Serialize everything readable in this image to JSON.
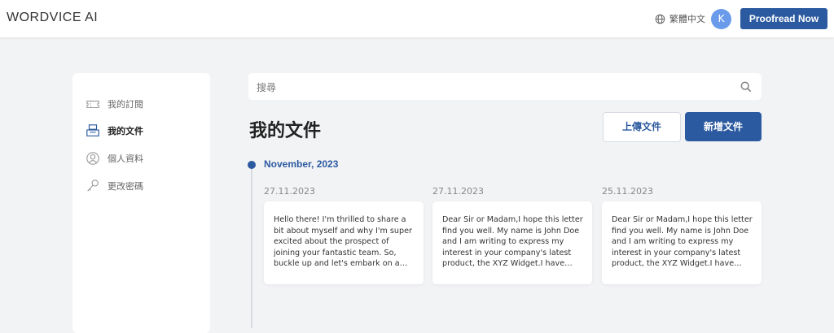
{
  "header": {
    "logo": "WORDVICE AI",
    "language": "繁體中文",
    "avatar_initial": "K",
    "proofread_label": "Proofread Now"
  },
  "sidebar": {
    "items": [
      {
        "label": "我的訂閱",
        "icon": "ticket-icon",
        "active": false
      },
      {
        "label": "我的文件",
        "icon": "document-stack-icon",
        "active": true
      },
      {
        "label": "個人資料",
        "icon": "profile-icon",
        "active": false
      },
      {
        "label": "更改密碼",
        "icon": "key-icon",
        "active": false
      }
    ]
  },
  "search": {
    "placeholder": "搜尋"
  },
  "main": {
    "title": "我的文件",
    "upload_label": "上傳文件",
    "new_label": "新增文件",
    "month": "November, 2023",
    "documents": [
      {
        "date": "27.11.2023",
        "preview": "Hello there! I'm thrilled to share a bit about myself and why I'm super excited about the prospect of joining your fantastic team. So, buckle up and let's embark on a journey"
      },
      {
        "date": "27.11.2023",
        "preview": "Dear Sir or Madam,I hope this letter find you well. My name is John Doe and I am writing to express my interest in your company's latest product, the XYZ Widget.I have been"
      },
      {
        "date": "25.11.2023",
        "preview": "Dear Sir or Madam,I hope this letter find you well. My name is John Doe and I am writing to express my interest in your company's latest product, the XYZ Widget.I have been"
      }
    ]
  },
  "colors": {
    "primary": "#2c5aa0",
    "avatar": "#6a9bea",
    "background": "#f2f3f5"
  }
}
